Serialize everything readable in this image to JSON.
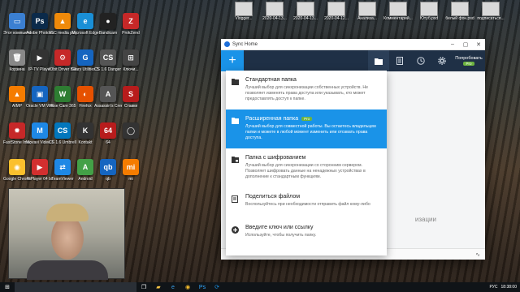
{
  "desktop": {
    "icons": [
      {
        "label": "Этот компьютер",
        "color": "#3b7fd1",
        "glyph": "▭"
      },
      {
        "label": "Adobe Photosho...",
        "color": "#0b2a4a",
        "glyph": "Ps"
      },
      {
        "label": "VLC media player",
        "color": "#f08a0a",
        "glyph": "▲"
      },
      {
        "label": "Microsoft Edge",
        "color": "#1a8fd6",
        "glyph": "e"
      },
      {
        "label": "Bandicam",
        "color": "#222",
        "glyph": "●"
      },
      {
        "label": "ProkZend",
        "color": "#c62828",
        "glyph": "Z"
      },
      {
        "label": "Корзина",
        "color": "#888",
        "glyph": "🗑"
      },
      {
        "label": "IP-TV Player",
        "color": "#333",
        "glyph": "▶"
      },
      {
        "label": "IObit Driver Booster",
        "color": "#c62828",
        "glyph": "⚙"
      },
      {
        "label": "Glary Utilities 5",
        "color": "#1565c0",
        "glyph": "G"
      },
      {
        "label": "CS 1.6 Danger Zone",
        "color": "#555",
        "glyph": "CS"
      },
      {
        "label": "Ключи...",
        "color": "#444",
        "glyph": "⊞"
      },
      {
        "label": "AIMP",
        "color": "#f57c00",
        "glyph": "▲"
      },
      {
        "label": "Oracle VM VirtualBox",
        "color": "#1565c0",
        "glyph": "▣"
      },
      {
        "label": "Wise Care 365",
        "color": "#2e7d32",
        "glyph": "W"
      },
      {
        "label": "Firefox",
        "color": "#e65100",
        "glyph": "◐"
      },
      {
        "label": "Assassin's Creed",
        "color": "#555",
        "glyph": "A"
      },
      {
        "label": "Ставки",
        "color": "#b71c1c",
        "glyph": "S"
      },
      {
        "label": "FastStone Image Viewer",
        "color": "#c62828",
        "glyph": "✹"
      },
      {
        "label": "Movavi Video Editor",
        "color": "#1e88e5",
        "glyph": "M"
      },
      {
        "label": "CS 1.6 Umbrella",
        "color": "#0277bd",
        "glyph": "CS"
      },
      {
        "label": "Kontakt",
        "color": "#333",
        "glyph": "K"
      },
      {
        "label": "64",
        "color": "#b71c1c",
        "glyph": "64"
      },
      {
        "label": "",
        "color": "#333",
        "glyph": "◯"
      },
      {
        "label": "Google Chrome",
        "color": "#fbc02d",
        "glyph": "◉"
      },
      {
        "label": "RtPlayer 64 bit",
        "color": "#d32f2f",
        "glyph": "▶"
      },
      {
        "label": "TeamViewer",
        "color": "#1e88e5",
        "glyph": "⇄"
      },
      {
        "label": "Android",
        "color": "#43a047",
        "glyph": "A"
      },
      {
        "label": "qb",
        "color": "#1565c0",
        "glyph": "qb"
      },
      {
        "label": "mi",
        "color": "#f57c00",
        "glyph": "mi"
      }
    ],
    "top_thumbs": [
      "Vlogger...",
      "2020-04-13...",
      "2020-04-13...",
      "2020-04-12...",
      "Анализа...",
      "Комментарий...",
      "Ютуб.psd",
      "белый фон.psd",
      "подписаться..."
    ]
  },
  "window": {
    "title": "Sync Home",
    "upgrade_label": "Попробовать",
    "upgrade_badge": "Pro",
    "background_hint": "изации"
  },
  "menu": {
    "items": [
      {
        "title": "Стандартная папка",
        "desc": "Лучший выбор для синхронизации собственных устройств. Не позволяет изменять права доступа или указывать, кто может предоставлять доступ к папке."
      },
      {
        "title": "Расширенная папка",
        "badge": "Pro",
        "desc": "Лучший выбор для совместной работы. Вы остаетесь владельцем папки и можете в любой момент изменить или отозвать права доступа."
      },
      {
        "title": "Папка с шифрованием",
        "desc": "Лучший выбор для синхронизации со сторонним сервером. Позволяет шифровать данные на ненадежных устройствах в дополнение к стандартным функциям."
      },
      {
        "title": "Поделиться файлом",
        "desc": "Воспользуйтесь при необходимости отправить файл кому-либо"
      },
      {
        "title": "Введите ключ или ссылку",
        "desc": "Используйте, чтобы получить папку."
      }
    ]
  },
  "taskbar": {
    "search_placeholder": "",
    "lang": "РУС",
    "time": "18:38:00"
  }
}
